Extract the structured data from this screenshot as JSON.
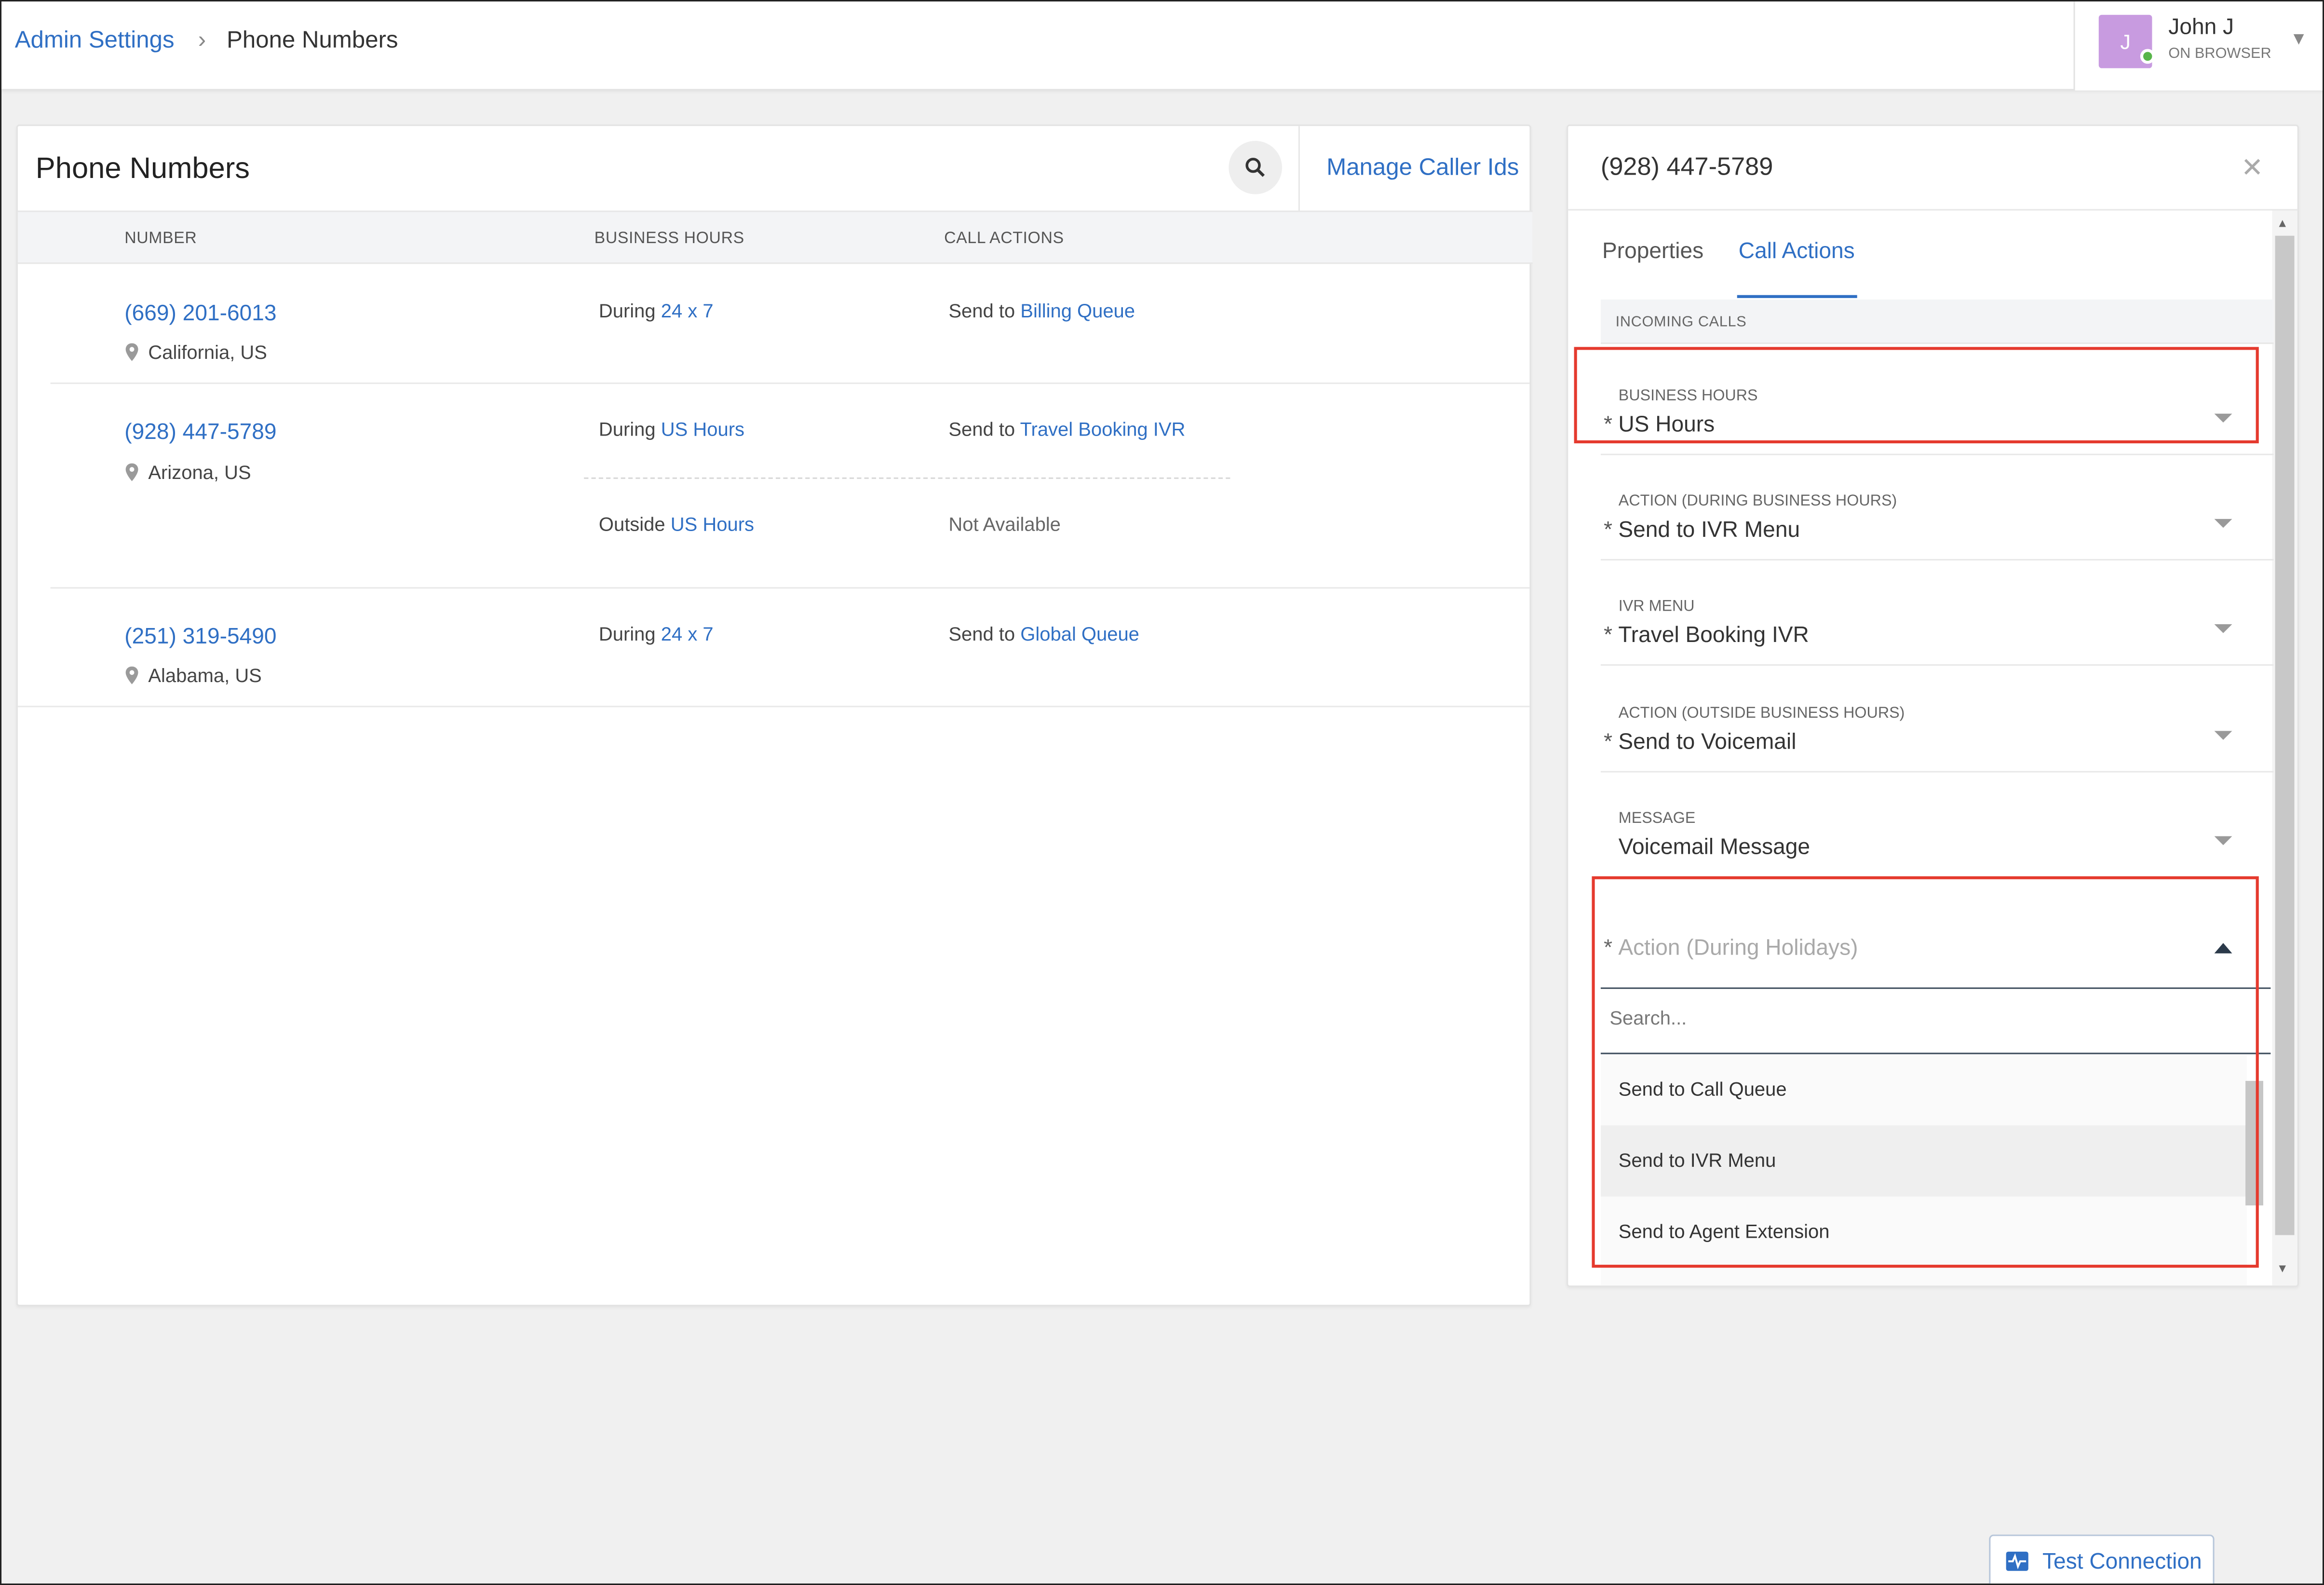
{
  "breadcrumb": {
    "parent": "Admin Settings",
    "current": "Phone Numbers"
  },
  "user": {
    "initial": "J",
    "name": "John J",
    "status": "ON BROWSER",
    "presence_color": "#58b54a"
  },
  "left_panel": {
    "title": "Phone Numbers",
    "manage_link": "Manage Caller Ids",
    "columns": [
      "NUMBER",
      "BUSINESS HOURS",
      "CALL ACTIONS"
    ],
    "rows": [
      {
        "number": "(669) 201-6013",
        "location": "California, US",
        "rules": [
          {
            "when": "During",
            "hours": "24 x 7",
            "action_prefix": "Send to",
            "action_target": "Billing Queue"
          }
        ]
      },
      {
        "number": "(928) 447-5789",
        "location": "Arizona, US",
        "rules": [
          {
            "when": "During",
            "hours": "US Hours",
            "action_prefix": "Send to",
            "action_target": "Travel Booking IVR"
          },
          {
            "when": "Outside",
            "hours": "US Hours",
            "action_text": "Not Available"
          }
        ]
      },
      {
        "number": "(251) 319-5490",
        "location": "Alabama, US",
        "rules": [
          {
            "when": "During",
            "hours": "24 x 7",
            "action_prefix": "Send to",
            "action_target": "Global Queue"
          }
        ]
      }
    ]
  },
  "right_panel": {
    "title": "(928) 447-5789",
    "tabs": [
      "Properties",
      "Call Actions"
    ],
    "active_tab": "Call Actions",
    "section": "INCOMING CALLS",
    "fields": [
      {
        "label": "BUSINESS HOURS",
        "value": "US Hours",
        "required": "*"
      },
      {
        "label": "ACTION (DURING BUSINESS HOURS)",
        "value": "Send to IVR Menu",
        "required": "*"
      },
      {
        "label": "IVR MENU",
        "value": "Travel Booking IVR",
        "required": "*"
      },
      {
        "label": "ACTION (OUTSIDE BUSINESS HOURS)",
        "value": "Send to Voicemail",
        "required": "*"
      },
      {
        "label": "MESSAGE",
        "value": "Voicemail Message",
        "required": ""
      }
    ],
    "dropdown": {
      "placeholder": "Action (During Holidays)",
      "required": "*",
      "search_placeholder": "Search...",
      "options": [
        "Send to Call Queue",
        "Send to IVR Menu",
        "Send to Agent Extension"
      ],
      "hovered": "Send to IVR Menu"
    }
  },
  "footer": {
    "test_connection": "Test Connection"
  },
  "colors": {
    "accent": "#2f6fc4",
    "highlight": "#e53a2e",
    "avatar": "#c89be0"
  }
}
